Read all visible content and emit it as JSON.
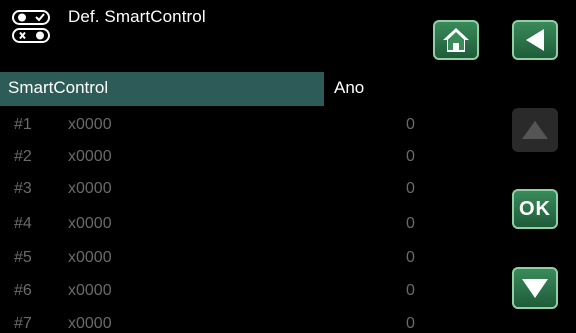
{
  "header": {
    "title": "Def. SmartControl",
    "icon": "toggle-switch-icon"
  },
  "buttons": {
    "home": "home-icon",
    "back": "back-arrow-icon",
    "up": "up-arrow-icon",
    "ok": "OK",
    "down": "down-arrow-icon"
  },
  "selected": {
    "label": "SmartControl",
    "value": "Ano"
  },
  "rows": [
    {
      "num": "#1",
      "name": "x0000",
      "value": "0"
    },
    {
      "num": "#2",
      "name": "x0000",
      "value": "0"
    },
    {
      "num": "#3",
      "name": "x0000",
      "value": "0"
    },
    {
      "num": "#4",
      "name": "x0000",
      "value": "0"
    },
    {
      "num": "#5",
      "name": "x0000",
      "value": "0"
    },
    {
      "num": "#6",
      "name": "x0000",
      "value": "0"
    },
    {
      "num": "#7",
      "name": "x0000",
      "value": "0"
    }
  ],
  "colors": {
    "accent": "#2d5b58",
    "button": "#2f7a4f",
    "button_border": "#8fd0a5",
    "dim_text": "#6a6a6a"
  }
}
